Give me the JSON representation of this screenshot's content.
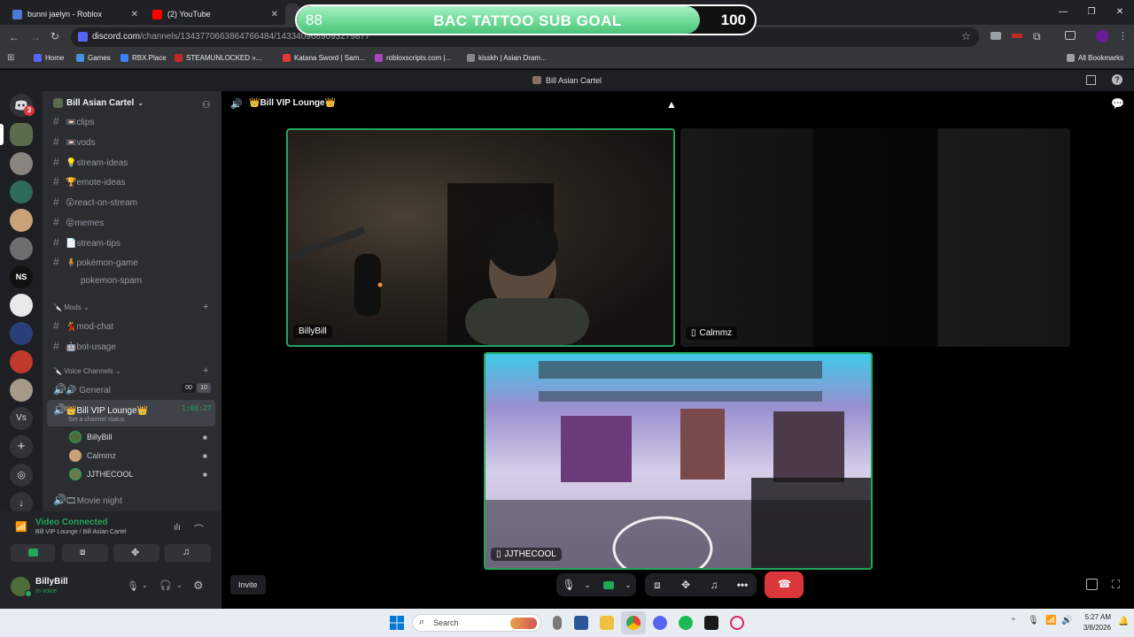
{
  "browser": {
    "tabs": [
      {
        "title": "bunni jaelyn - Roblox",
        "close": "✕"
      },
      {
        "title": "(2) YouTube",
        "close": "✕"
      }
    ],
    "url": "discord.com/channels/1343770663864766484/1433409689093279877",
    "url_host": "discord.com",
    "url_path": "/channels/1343770663864766484/1433409689093279877",
    "window_controls": [
      "—",
      "❐",
      "✕"
    ],
    "bookmarks": [
      "Home",
      "Games",
      "RBX.Place",
      "STEAMUNLOCKED »...",
      "Katana Sword | Sam...",
      "robloxscripts.com |...",
      "kisskh | Asian Dram...",
      "All Bookmarks"
    ],
    "bookmark_colors": [
      "#5865f2",
      "#4a90e2",
      "#3b82f6",
      "#c62828",
      "#e53935",
      "#ab47bc",
      "#888888",
      "#9aa0a6"
    ]
  },
  "sub_goal": {
    "current": "88",
    "title": "BAC TATTOO SUB GOAL",
    "target": "100",
    "progress": 0.88,
    "bar_color": "#6bd894"
  },
  "discord": {
    "window_title": "Bill Asian Cartel",
    "server_name": "Bill Asian Cartel",
    "notification_count": "3",
    "rail_label_ns": "NS",
    "rail_label_vs": "Vs",
    "channels": [
      {
        "name": "clips",
        "emoji": "📼"
      },
      {
        "name": "vods",
        "emoji": "📼"
      },
      {
        "name": "stream-ideas",
        "emoji": "💡"
      },
      {
        "name": "emote-ideas",
        "emoji": "🏆"
      },
      {
        "name": "react-on-stream",
        "emoji": "😲"
      },
      {
        "name": "memes",
        "emoji": "😝"
      },
      {
        "name": "stream-tips",
        "emoji": "📄"
      },
      {
        "name": "pokémon-game",
        "emoji": "🧍"
      },
      {
        "name": "pokemon-spam",
        "emoji": ""
      }
    ],
    "mods_category": "Mods",
    "mod_channels": [
      {
        "name": "mod-chat",
        "emoji": "💃"
      },
      {
        "name": "bot-usage",
        "emoji": "🤖"
      }
    ],
    "voice_category": "Voice Channels",
    "voice_general": "General",
    "voice_general_counts": [
      "00",
      "10"
    ],
    "active_voice": "Bill VIP Lounge",
    "active_voice_timer": "1:06:27",
    "channel_status": "Set a channel status",
    "voice_users": [
      "BillyBill",
      "Calmmz",
      "JJTHECOOL"
    ],
    "movie_night": "Movie night",
    "connection_status": "Video Connected",
    "connection_location": "Bill VIP Lounge / Bill Asian Cartel",
    "username": "BillyBill",
    "user_status": "In voice",
    "call_header": "Bill VIP Lounge",
    "tiles": [
      {
        "name": "BillyBill"
      },
      {
        "name": "Calmmz"
      },
      {
        "name": "JJTHECOOL"
      }
    ],
    "invite_label": "Invite",
    "accent_green": "#23a55a",
    "hangup_color": "#da373c"
  },
  "taskbar": {
    "search_placeholder": "Search",
    "time": "5:27 AM",
    "date": "3/8/2026"
  }
}
